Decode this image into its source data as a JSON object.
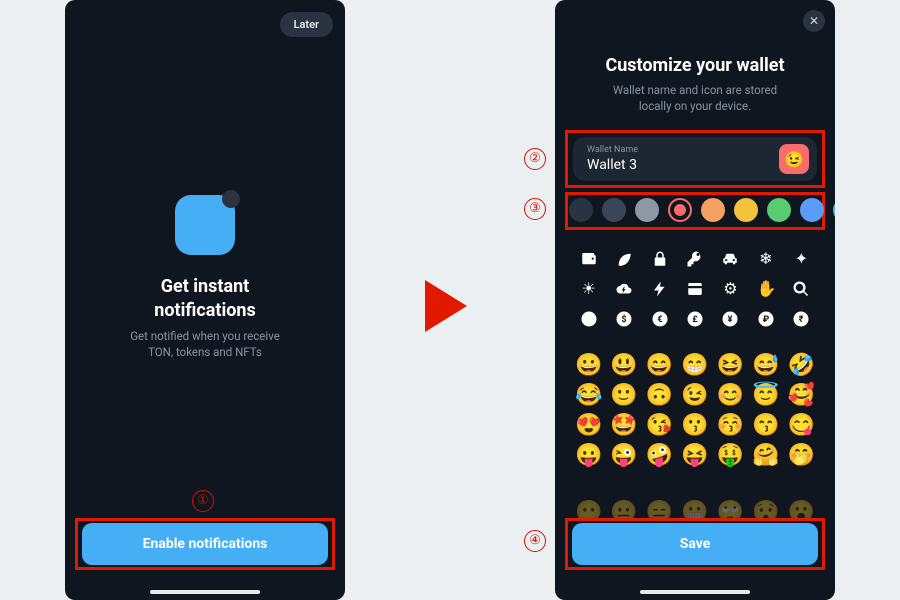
{
  "left": {
    "later": "Later",
    "title_line1": "Get instant",
    "title_line2": "notifications",
    "subtitle_line1": "Get notified when you receive",
    "subtitle_line2": "TON, tokens and NFTs",
    "enable_btn": "Enable notifications"
  },
  "right": {
    "close": "✕",
    "title": "Customize your wallet",
    "sub_line1": "Wallet name and icon are stored",
    "sub_line2": "locally on your device.",
    "name_label": "Wallet Name",
    "name_value": "Wallet 3",
    "selected_emoji": "😉",
    "colors": [
      "#293342",
      "#3A4657",
      "#8F97A3",
      "SELECTED",
      "#F5A166",
      "#F5C23E",
      "#5ACB70",
      "#5B9DF6",
      "#4DBFE8"
    ],
    "icons": [
      "wallet",
      "leaf",
      "lock",
      "key",
      "car",
      "snowflake",
      "sparkle",
      "sun",
      "cloud-bolt",
      "bolt",
      "credit-card",
      "gear",
      "hand",
      "search",
      "power",
      "dollar",
      "euro",
      "pound",
      "yen",
      "ruble",
      "rupee"
    ],
    "emojis": [
      "😀",
      "😃",
      "😄",
      "😁",
      "😆",
      "😅",
      "🤣",
      "😂",
      "🙂",
      "🙃",
      "😉",
      "😊",
      "😇",
      "🥰",
      "😍",
      "🤩",
      "😘",
      "😗",
      "😚",
      "😙",
      "😋",
      "😛",
      "😜",
      "🤪",
      "😝",
      "🤑",
      "🤗",
      "🤭"
    ],
    "save_btn": "Save"
  },
  "markers": {
    "m1": "①",
    "m2": "②",
    "m3": "③",
    "m4": "④"
  }
}
